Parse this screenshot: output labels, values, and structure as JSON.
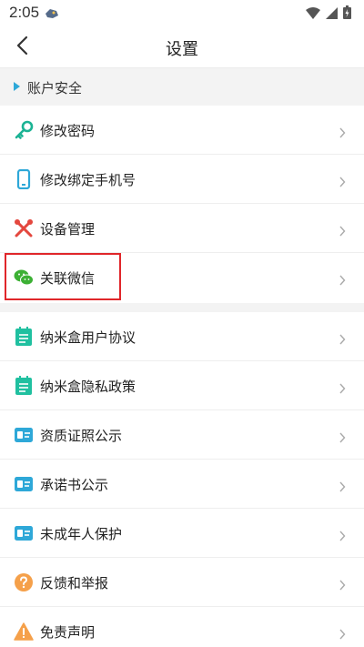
{
  "status_bar": {
    "time": "2:05"
  },
  "header": {
    "title": "设置"
  },
  "section": {
    "title": "账户安全"
  },
  "items": [
    {
      "label": "修改密码",
      "icon": "key-icon"
    },
    {
      "label": "修改绑定手机号",
      "icon": "phone-icon"
    },
    {
      "label": "设备管理",
      "icon": "tools-icon"
    },
    {
      "label": "关联微信",
      "icon": "wechat-icon",
      "highlighted": true
    },
    {
      "label": "纳米盒用户协议",
      "icon": "document-icon"
    },
    {
      "label": "纳米盒隐私政策",
      "icon": "document-icon"
    },
    {
      "label": "资质证照公示",
      "icon": "id-card-icon"
    },
    {
      "label": "承诺书公示",
      "icon": "id-card-icon"
    },
    {
      "label": "未成年人保护",
      "icon": "id-card-icon"
    },
    {
      "label": "反馈和举报",
      "icon": "help-icon"
    },
    {
      "label": "免责声明",
      "icon": "warning-icon"
    }
  ],
  "colors": {
    "accent_blue": "#2ea8d8",
    "key_green": "#1bb394",
    "tools_red": "#e4473e",
    "wechat_green": "#3cb034",
    "doc_teal": "#20c0a0",
    "help_orange": "#f5a04a",
    "highlight_red": "#e0262a"
  }
}
